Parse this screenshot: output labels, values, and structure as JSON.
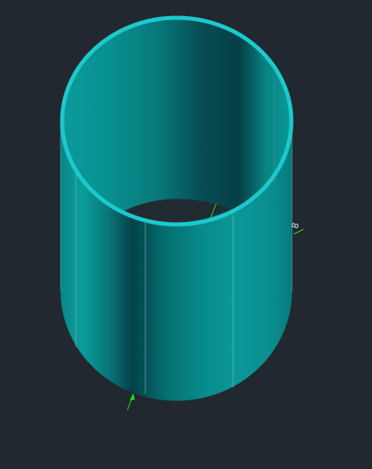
{
  "viewport": {
    "background_color": "#212830",
    "model": "hollow-cylinder",
    "visual_style": "shaded"
  },
  "colors": {
    "shell_light": "#0fa3a3",
    "shell_mid": "#0a8a8a",
    "shell_dark": "#043c42",
    "interior_light": "#0a9191",
    "interior_dark": "#06484e",
    "rim": "#1cc9cc",
    "edge_line": "#9fb7b7",
    "hole": "#222a31",
    "dimension": "#19e619"
  },
  "annotations": {
    "partial_dimension_text": "8"
  }
}
